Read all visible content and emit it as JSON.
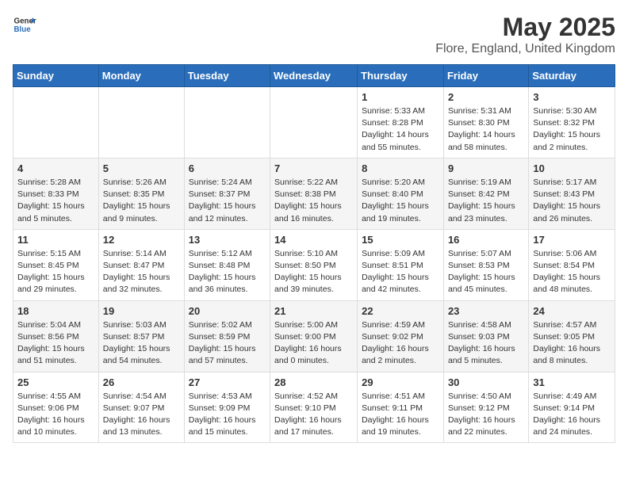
{
  "header": {
    "logo": {
      "general": "General",
      "blue": "Blue"
    },
    "title": "May 2025",
    "subtitle": "Flore, England, United Kingdom"
  },
  "days_of_week": [
    "Sunday",
    "Monday",
    "Tuesday",
    "Wednesday",
    "Thursday",
    "Friday",
    "Saturday"
  ],
  "weeks": [
    [
      {
        "day": "",
        "info": ""
      },
      {
        "day": "",
        "info": ""
      },
      {
        "day": "",
        "info": ""
      },
      {
        "day": "",
        "info": ""
      },
      {
        "day": "1",
        "info": "Sunrise: 5:33 AM\nSunset: 8:28 PM\nDaylight: 14 hours\nand 55 minutes."
      },
      {
        "day": "2",
        "info": "Sunrise: 5:31 AM\nSunset: 8:30 PM\nDaylight: 14 hours\nand 58 minutes."
      },
      {
        "day": "3",
        "info": "Sunrise: 5:30 AM\nSunset: 8:32 PM\nDaylight: 15 hours\nand 2 minutes."
      }
    ],
    [
      {
        "day": "4",
        "info": "Sunrise: 5:28 AM\nSunset: 8:33 PM\nDaylight: 15 hours\nand 5 minutes."
      },
      {
        "day": "5",
        "info": "Sunrise: 5:26 AM\nSunset: 8:35 PM\nDaylight: 15 hours\nand 9 minutes."
      },
      {
        "day": "6",
        "info": "Sunrise: 5:24 AM\nSunset: 8:37 PM\nDaylight: 15 hours\nand 12 minutes."
      },
      {
        "day": "7",
        "info": "Sunrise: 5:22 AM\nSunset: 8:38 PM\nDaylight: 15 hours\nand 16 minutes."
      },
      {
        "day": "8",
        "info": "Sunrise: 5:20 AM\nSunset: 8:40 PM\nDaylight: 15 hours\nand 19 minutes."
      },
      {
        "day": "9",
        "info": "Sunrise: 5:19 AM\nSunset: 8:42 PM\nDaylight: 15 hours\nand 23 minutes."
      },
      {
        "day": "10",
        "info": "Sunrise: 5:17 AM\nSunset: 8:43 PM\nDaylight: 15 hours\nand 26 minutes."
      }
    ],
    [
      {
        "day": "11",
        "info": "Sunrise: 5:15 AM\nSunset: 8:45 PM\nDaylight: 15 hours\nand 29 minutes."
      },
      {
        "day": "12",
        "info": "Sunrise: 5:14 AM\nSunset: 8:47 PM\nDaylight: 15 hours\nand 32 minutes."
      },
      {
        "day": "13",
        "info": "Sunrise: 5:12 AM\nSunset: 8:48 PM\nDaylight: 15 hours\nand 36 minutes."
      },
      {
        "day": "14",
        "info": "Sunrise: 5:10 AM\nSunset: 8:50 PM\nDaylight: 15 hours\nand 39 minutes."
      },
      {
        "day": "15",
        "info": "Sunrise: 5:09 AM\nSunset: 8:51 PM\nDaylight: 15 hours\nand 42 minutes."
      },
      {
        "day": "16",
        "info": "Sunrise: 5:07 AM\nSunset: 8:53 PM\nDaylight: 15 hours\nand 45 minutes."
      },
      {
        "day": "17",
        "info": "Sunrise: 5:06 AM\nSunset: 8:54 PM\nDaylight: 15 hours\nand 48 minutes."
      }
    ],
    [
      {
        "day": "18",
        "info": "Sunrise: 5:04 AM\nSunset: 8:56 PM\nDaylight: 15 hours\nand 51 minutes."
      },
      {
        "day": "19",
        "info": "Sunrise: 5:03 AM\nSunset: 8:57 PM\nDaylight: 15 hours\nand 54 minutes."
      },
      {
        "day": "20",
        "info": "Sunrise: 5:02 AM\nSunset: 8:59 PM\nDaylight: 15 hours\nand 57 minutes."
      },
      {
        "day": "21",
        "info": "Sunrise: 5:00 AM\nSunset: 9:00 PM\nDaylight: 16 hours\nand 0 minutes."
      },
      {
        "day": "22",
        "info": "Sunrise: 4:59 AM\nSunset: 9:02 PM\nDaylight: 16 hours\nand 2 minutes."
      },
      {
        "day": "23",
        "info": "Sunrise: 4:58 AM\nSunset: 9:03 PM\nDaylight: 16 hours\nand 5 minutes."
      },
      {
        "day": "24",
        "info": "Sunrise: 4:57 AM\nSunset: 9:05 PM\nDaylight: 16 hours\nand 8 minutes."
      }
    ],
    [
      {
        "day": "25",
        "info": "Sunrise: 4:55 AM\nSunset: 9:06 PM\nDaylight: 16 hours\nand 10 minutes."
      },
      {
        "day": "26",
        "info": "Sunrise: 4:54 AM\nSunset: 9:07 PM\nDaylight: 16 hours\nand 13 minutes."
      },
      {
        "day": "27",
        "info": "Sunrise: 4:53 AM\nSunset: 9:09 PM\nDaylight: 16 hours\nand 15 minutes."
      },
      {
        "day": "28",
        "info": "Sunrise: 4:52 AM\nSunset: 9:10 PM\nDaylight: 16 hours\nand 17 minutes."
      },
      {
        "day": "29",
        "info": "Sunrise: 4:51 AM\nSunset: 9:11 PM\nDaylight: 16 hours\nand 19 minutes."
      },
      {
        "day": "30",
        "info": "Sunrise: 4:50 AM\nSunset: 9:12 PM\nDaylight: 16 hours\nand 22 minutes."
      },
      {
        "day": "31",
        "info": "Sunrise: 4:49 AM\nSunset: 9:14 PM\nDaylight: 16 hours\nand 24 minutes."
      }
    ]
  ]
}
